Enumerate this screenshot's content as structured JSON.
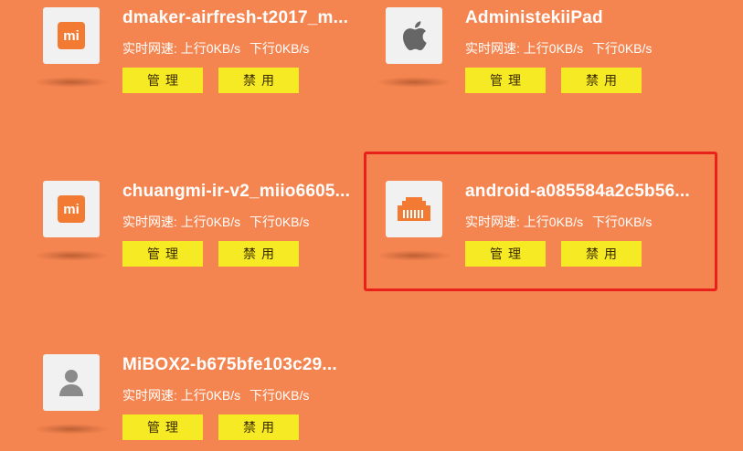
{
  "devices": [
    {
      "name": "dmaker-airfresh-t2017_m...",
      "icon": "xiaomi-logo-icon",
      "icon_text": "mi",
      "speed_label": "实时网速:",
      "upload": "上行0KB/s",
      "download": "下行0KB/s",
      "manage_label": "管理",
      "disable_label": "禁用"
    },
    {
      "name": "AdministekiiPad",
      "icon": "apple-logo-icon",
      "speed_label": "实时网速:",
      "upload": "上行0KB/s",
      "download": "下行0KB/s",
      "manage_label": "管理",
      "disable_label": "禁用"
    },
    {
      "name": "chuangmi-ir-v2_miio6605...",
      "icon": "xiaomi-logo-icon",
      "icon_text": "mi",
      "speed_label": "实时网速:",
      "upload": "上行0KB/s",
      "download": "下行0KB/s",
      "manage_label": "管理",
      "disable_label": "禁用"
    },
    {
      "name": "android-a085584a2c5b56...",
      "icon": "ethernet-port-icon",
      "speed_label": "实时网速:",
      "upload": "上行0KB/s",
      "download": "下行0KB/s",
      "manage_label": "管理",
      "disable_label": "禁用",
      "highlighted": true
    },
    {
      "name": "MiBOX2-b675bfe103c29...",
      "icon": "user-avatar-icon",
      "speed_label": "实时网速:",
      "upload": "上行0KB/s",
      "download": "下行0KB/s",
      "manage_label": "管理",
      "disable_label": "禁用"
    }
  ],
  "colors": {
    "background": "#f58550",
    "button": "#f6ea24",
    "highlight_border": "#e8221a",
    "icon_box": "#f1f1f1",
    "mi_orange": "#f27a32"
  }
}
